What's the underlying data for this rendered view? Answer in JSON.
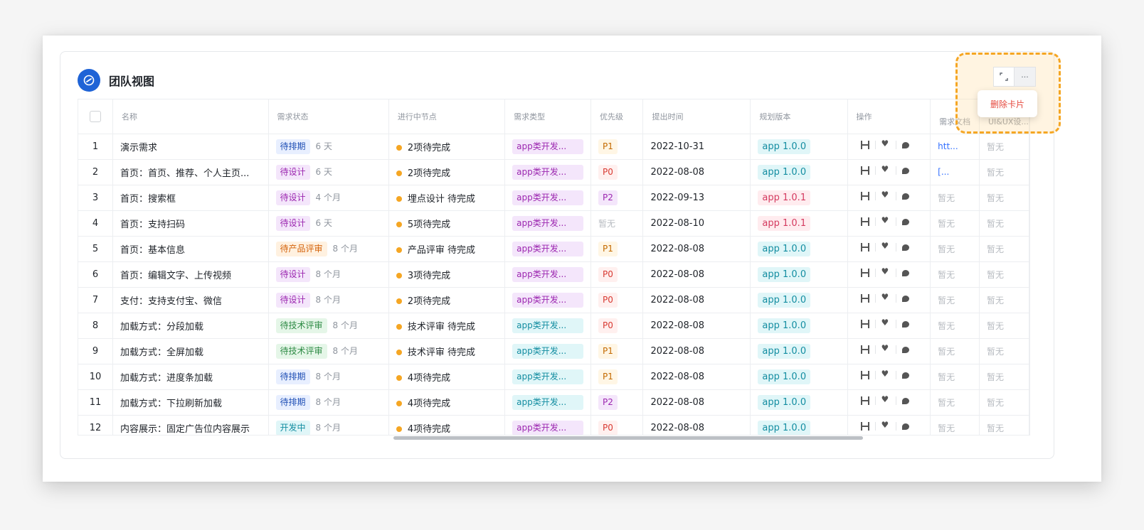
{
  "card": {
    "title": "团队视图"
  },
  "columns": [
    "名称",
    "需求状态",
    "进行中节点",
    "需求类型",
    "优先级",
    "提出时间",
    "规划版本",
    "操作",
    "需求文档",
    "UI&UX设..."
  ],
  "rows": [
    {
      "no": "1",
      "name": "演示需求",
      "status": "待排期",
      "status_color": "blue",
      "duration": "6 天",
      "node": "2项待完成",
      "type": "app类开发...",
      "type_color": "purple",
      "priority": "P1",
      "date": "2022-10-31",
      "version": "app 1.0.0",
      "version_color": "cyan",
      "doc": "htt...",
      "ui": "暂无"
    },
    {
      "no": "2",
      "name": "首页：首页、推荐、个人主页...",
      "status": "待设计",
      "status_color": "purple",
      "duration": "6 天",
      "node": "2项待完成",
      "type": "app类开发...",
      "type_color": "purple",
      "priority": "P0",
      "date": "2022-08-08",
      "version": "app 1.0.0",
      "version_color": "cyan",
      "doc": "[...",
      "ui": "暂无"
    },
    {
      "no": "3",
      "name": "首页：搜索框",
      "status": "待设计",
      "status_color": "purple",
      "duration": "4 个月",
      "node": "埋点设计 待完成",
      "type": "app类开发...",
      "type_color": "purple",
      "priority": "P2",
      "date": "2022-09-13",
      "version": "app 1.0.1",
      "version_color": "red",
      "doc": "暂无",
      "ui": "暂无"
    },
    {
      "no": "4",
      "name": "首页：支持扫码",
      "status": "待设计",
      "status_color": "purple",
      "duration": "6 天",
      "node": "5项待完成",
      "type": "app类开发...",
      "type_color": "purple",
      "priority": "暂无",
      "date": "2022-08-10",
      "version": "app 1.0.1",
      "version_color": "red",
      "doc": "暂无",
      "ui": "暂无"
    },
    {
      "no": "5",
      "name": "首页：基本信息",
      "status": "待产品评审",
      "status_color": "orange",
      "duration": "8 个月",
      "node": "产品评审 待完成",
      "type": "app类开发...",
      "type_color": "purple",
      "priority": "P1",
      "date": "2022-08-08",
      "version": "app 1.0.0",
      "version_color": "cyan",
      "doc": "暂无",
      "ui": "暂无"
    },
    {
      "no": "6",
      "name": "首页：编辑文字、上传视频",
      "status": "待设计",
      "status_color": "purple",
      "duration": "8 个月",
      "node": "3项待完成",
      "type": "app类开发...",
      "type_color": "purple",
      "priority": "P0",
      "date": "2022-08-08",
      "version": "app 1.0.0",
      "version_color": "cyan",
      "doc": "暂无",
      "ui": "暂无"
    },
    {
      "no": "7",
      "name": "支付：支持支付宝、微信",
      "status": "待设计",
      "status_color": "purple",
      "duration": "8 个月",
      "node": "2项待完成",
      "type": "app类开发...",
      "type_color": "purple",
      "priority": "P0",
      "date": "2022-08-08",
      "version": "app 1.0.0",
      "version_color": "cyan",
      "doc": "暂无",
      "ui": "暂无"
    },
    {
      "no": "8",
      "name": "加载方式：分段加载",
      "status": "待技术评审",
      "status_color": "green",
      "duration": "8 个月",
      "node": "技术评审 待完成",
      "type": "app类开发...",
      "type_color": "cyan",
      "priority": "P0",
      "date": "2022-08-08",
      "version": "app 1.0.0",
      "version_color": "cyan",
      "doc": "暂无",
      "ui": "暂无"
    },
    {
      "no": "9",
      "name": "加载方式：全屏加载",
      "status": "待技术评审",
      "status_color": "green",
      "duration": "8 个月",
      "node": "技术评审 待完成",
      "type": "app类开发...",
      "type_color": "cyan",
      "priority": "P1",
      "date": "2022-08-08",
      "version": "app 1.0.0",
      "version_color": "cyan",
      "doc": "暂无",
      "ui": "暂无"
    },
    {
      "no": "10",
      "name": "加载方式：进度条加载",
      "status": "待排期",
      "status_color": "blue",
      "duration": "8 个月",
      "node": "4项待完成",
      "type": "app类开发...",
      "type_color": "cyan",
      "priority": "P1",
      "date": "2022-08-08",
      "version": "app 1.0.0",
      "version_color": "cyan",
      "doc": "暂无",
      "ui": "暂无"
    },
    {
      "no": "11",
      "name": "加载方式：下拉刷新加载",
      "status": "待排期",
      "status_color": "blue",
      "duration": "8 个月",
      "node": "4项待完成",
      "type": "app类开发...",
      "type_color": "cyan",
      "priority": "P2",
      "date": "2022-08-08",
      "version": "app 1.0.0",
      "version_color": "cyan",
      "doc": "暂无",
      "ui": "暂无"
    },
    {
      "no": "12",
      "name": "内容展示：固定广告位内容展示",
      "status": "开发中",
      "status_color": "cyan",
      "duration": "8 个月",
      "node": "4项待完成",
      "type": "app类开发...",
      "type_color": "purple",
      "priority": "P0",
      "date": "2022-08-08",
      "version": "app 1.0.0",
      "version_color": "cyan",
      "doc": "暂无",
      "ui": "暂无"
    }
  ],
  "toolbar": {
    "expand_icon": "expand-icon",
    "more_label": "···"
  },
  "menu": {
    "delete_label": "删除卡片"
  }
}
